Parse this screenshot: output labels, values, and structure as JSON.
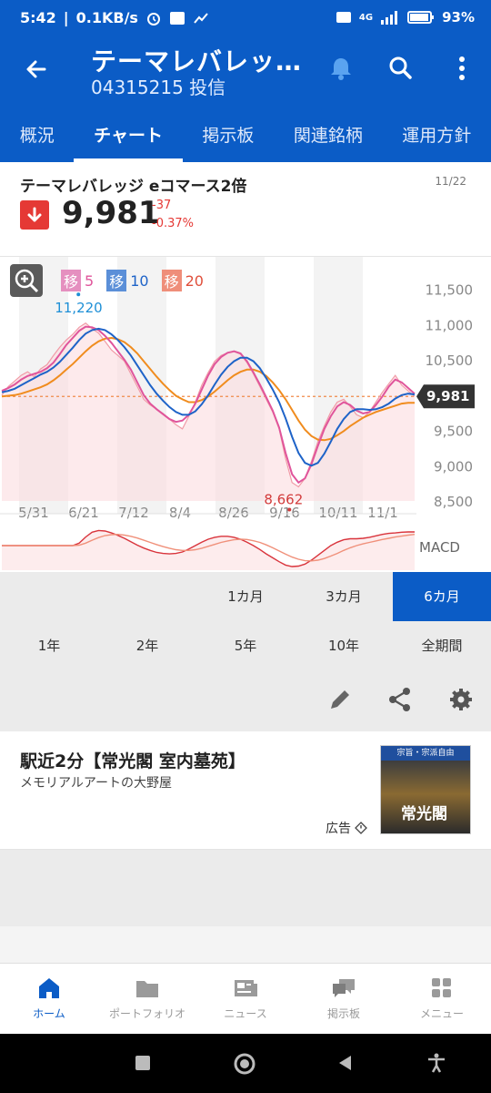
{
  "status": {
    "time": "5:42",
    "speed": "0.1KB/s",
    "battery": "93%",
    "net": "4G"
  },
  "header": {
    "title": "テーマレバレッ…",
    "code": "04315215 投信"
  },
  "tabs": [
    {
      "label": "概況"
    },
    {
      "label": "チャート"
    },
    {
      "label": "掲示板"
    },
    {
      "label": "関連銘柄"
    },
    {
      "label": "運用方針"
    }
  ],
  "stock": {
    "name": "テーマレバレッジ eコマース2倍",
    "date": "11/22",
    "price": "9,981",
    "change": "-37",
    "change_pct": "-0.37%"
  },
  "chart_data": {
    "type": "line",
    "ma_legend": [
      {
        "label": "移",
        "period": "5",
        "color": "#e0559b"
      },
      {
        "label": "移",
        "period": "10",
        "color": "#1e63c8"
      },
      {
        "label": "移",
        "period": "20",
        "color": "#f07a4a"
      }
    ],
    "x_ticks": [
      "5/31",
      "6/21",
      "7/12",
      "8/4",
      "8/26",
      "9/16",
      "10/11",
      "11/1"
    ],
    "y_ticks": [
      "11,500",
      "11,000",
      "10,500",
      "10,000",
      "9,500",
      "9,000",
      "8,500"
    ],
    "ylim": [
      8500,
      11700
    ],
    "high_label": "11,220",
    "low_label": "8,662",
    "last_label": "9,981",
    "last_value": 9981,
    "indicator_label": "MACD",
    "price": [
      10000,
      10120,
      10200,
      10280,
      10330,
      10260,
      10370,
      10430,
      10560,
      10680,
      10780,
      10860,
      10960,
      11020,
      10940,
      10880,
      10760,
      10640,
      10560,
      10480,
      10300,
      10120,
      9940,
      9860,
      9800,
      9740,
      9660,
      9580,
      9520,
      9700,
      9900,
      10140,
      10320,
      10480,
      10560,
      10600,
      10620,
      10580,
      10460,
      10300,
      10120,
      9940,
      9760,
      9520,
      9100,
      8760,
      8700,
      8820,
      9060,
      9340,
      9560,
      9760,
      9900,
      9940,
      9840,
      9720,
      9680,
      9760,
      9900,
      10040,
      10160,
      10280,
      10140,
      10060,
      9981
    ],
    "ma5": [
      10060,
      10100,
      10150,
      10220,
      10270,
      10300,
      10330,
      10380,
      10460,
      10580,
      10710,
      10810,
      10910,
      10970,
      10960,
      10920,
      10840,
      10740,
      10620,
      10500,
      10360,
      10180,
      10000,
      9880,
      9800,
      9730,
      9660,
      9620,
      9640,
      9720,
      9880,
      10080,
      10280,
      10440,
      10540,
      10600,
      10620,
      10590,
      10480,
      10320,
      10150,
      9970,
      9780,
      9540,
      9180,
      8880,
      8760,
      8820,
      9020,
      9280,
      9520,
      9700,
      9840,
      9900,
      9860,
      9780,
      9740,
      9760,
      9860,
      9980,
      10120,
      10220,
      10180,
      10100,
      10020
    ],
    "ma10": [
      10040,
      10060,
      10090,
      10140,
      10190,
      10240,
      10290,
      10330,
      10390,
      10470,
      10570,
      10670,
      10780,
      10870,
      10920,
      10940,
      10920,
      10860,
      10780,
      10680,
      10560,
      10420,
      10280,
      10140,
      10020,
      9920,
      9830,
      9760,
      9720,
      9720,
      9770,
      9870,
      10000,
      10150,
      10290,
      10400,
      10480,
      10530,
      10530,
      10480,
      10380,
      10240,
      10080,
      9900,
      9670,
      9410,
      9180,
      9040,
      9000,
      9040,
      9170,
      9340,
      9520,
      9660,
      9760,
      9800,
      9800,
      9790,
      9800,
      9830,
      9880,
      9950,
      10000,
      10020,
      10010
    ],
    "ma20": [
      9980,
      9990,
      10000,
      10020,
      10050,
      10080,
      10110,
      10150,
      10210,
      10280,
      10360,
      10440,
      10530,
      10620,
      10700,
      10760,
      10800,
      10810,
      10790,
      10750,
      10680,
      10590,
      10480,
      10370,
      10260,
      10160,
      10070,
      9990,
      9940,
      9900,
      9900,
      9930,
      9980,
      10050,
      10130,
      10210,
      10280,
      10330,
      10360,
      10360,
      10330,
      10270,
      10180,
      10070,
      9940,
      9790,
      9640,
      9510,
      9420,
      9370,
      9360,
      9380,
      9430,
      9490,
      9560,
      9620,
      9680,
      9720,
      9760,
      9790,
      9820,
      9850,
      9880,
      9890,
      9890
    ],
    "macd": [
      0,
      0,
      0,
      0,
      0,
      0,
      0,
      0,
      0,
      0,
      0,
      0,
      0.1,
      0.35,
      0.55,
      0.62,
      0.6,
      0.52,
      0.42,
      0.3,
      0.16,
      0.02,
      -0.1,
      -0.2,
      -0.28,
      -0.32,
      -0.34,
      -0.32,
      -0.26,
      -0.14,
      0,
      0.14,
      0.26,
      0.34,
      0.38,
      0.38,
      0.34,
      0.26,
      0.14,
      0,
      -0.16,
      -0.34,
      -0.5,
      -0.66,
      -0.8,
      -0.86,
      -0.84,
      -0.76,
      -0.6,
      -0.4,
      -0.2,
      0,
      0.14,
      0.24,
      0.28,
      0.28,
      0.3,
      0.34,
      0.4,
      0.46,
      0.5,
      0.52,
      0.55,
      0.56,
      0.56
    ],
    "signal": [
      0,
      0,
      0,
      0,
      0,
      0,
      0,
      0,
      0,
      0,
      0,
      0,
      0.02,
      0.1,
      0.22,
      0.33,
      0.41,
      0.45,
      0.46,
      0.43,
      0.38,
      0.31,
      0.22,
      0.13,
      0.04,
      -0.04,
      -0.11,
      -0.17,
      -0.2,
      -0.2,
      -0.17,
      -0.11,
      -0.03,
      0.05,
      0.13,
      0.19,
      0.24,
      0.26,
      0.25,
      0.2,
      0.13,
      0.03,
      -0.09,
      -0.22,
      -0.35,
      -0.47,
      -0.56,
      -0.62,
      -0.63,
      -0.6,
      -0.53,
      -0.43,
      -0.32,
      -0.2,
      -0.09,
      0,
      0.07,
      0.13,
      0.19,
      0.25,
      0.3,
      0.35,
      0.39,
      0.43,
      0.46
    ]
  },
  "periods": {
    "row1": [
      "1カ月",
      "3カ月",
      "6カ月"
    ],
    "row2": [
      "1年",
      "2年",
      "5年",
      "10年",
      "全期間"
    ]
  },
  "ad": {
    "title": "駅近2分【常光閣 室内墓苑】",
    "sub": "メモリアルアートの大野屋",
    "label": "広告",
    "thumb_top": "宗旨・宗派自由",
    "thumb_big": "常光閣"
  },
  "nav": [
    {
      "label": "ホーム"
    },
    {
      "label": "ポートフォリオ"
    },
    {
      "label": "ニュース"
    },
    {
      "label": "掲示板"
    },
    {
      "label": "メニュー"
    }
  ]
}
